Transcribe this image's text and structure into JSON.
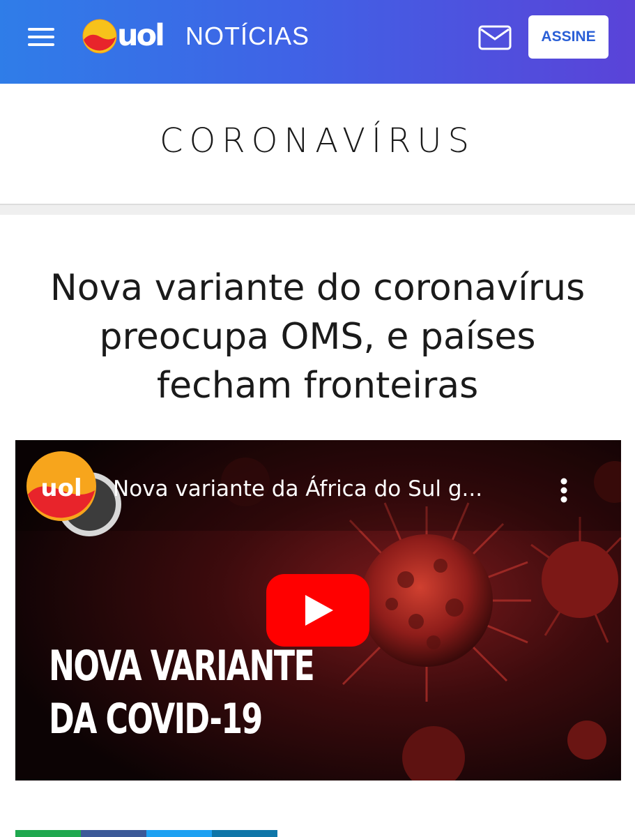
{
  "header": {
    "menu_icon": "hamburger-menu-icon",
    "logo_text": "uol",
    "section_label": "NOTÍCIAS",
    "mail_icon": "envelope-icon",
    "subscribe_label": "ASSINE",
    "gradient_start": "#2f7de8",
    "gradient_end": "#5a43d8"
  },
  "section": {
    "title": "CORONAVÍRUS"
  },
  "article": {
    "headline": "Nova variante do coronavírus preocupa OMS, e países fecham fronteiras"
  },
  "video": {
    "channel_logo_text": "uol",
    "title": "Nova variante da África do Sul g...",
    "more_icon": "vertical-dots-icon",
    "play_icon": "youtube-play-icon",
    "caption_lines": [
      "NOVA VARIANTE",
      "DA COVID-19"
    ],
    "play_color": "#ff0000"
  },
  "share_colors": [
    "#1fa84f",
    "#3b5998",
    "#1da1f2",
    "#0e76a8"
  ]
}
